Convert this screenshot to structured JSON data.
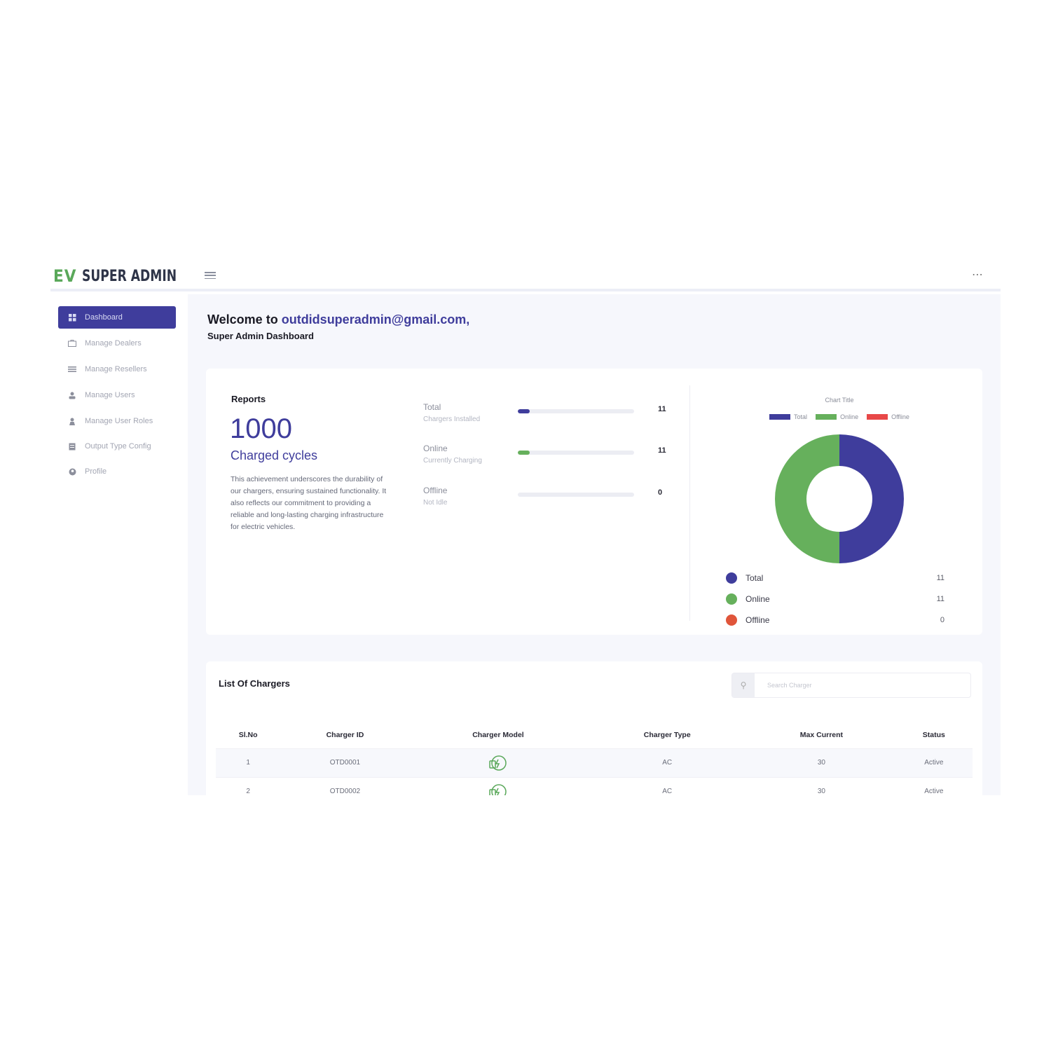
{
  "app": {
    "logo_mark": "EV",
    "logo_text": "SUPER ADMIN"
  },
  "sidebar": {
    "items": [
      {
        "label": "Dashboard",
        "icon": "dashboard-icon",
        "active": true
      },
      {
        "label": "Manage Dealers",
        "icon": "briefcase-icon",
        "active": false
      },
      {
        "label": "Manage Resellers",
        "icon": "list-icon",
        "active": false
      },
      {
        "label": "Manage Users",
        "icon": "users-icon",
        "active": false
      },
      {
        "label": "Manage User Roles",
        "icon": "user-icon",
        "active": false
      },
      {
        "label": "Output Type Config",
        "icon": "config-icon",
        "active": false
      },
      {
        "label": "Profile",
        "icon": "profile-icon",
        "active": false
      }
    ]
  },
  "header": {
    "welcome_prefix": "Welcome to",
    "email": "outdidsuperadmin@gmail.com,",
    "subtitle": "Super Admin Dashboard"
  },
  "reports": {
    "title": "Reports",
    "big_number": "1000",
    "big_label": "Charged cycles",
    "description": "This achievement underscores the durability of our chargers, ensuring sustained functionality. It also reflects our commitment to providing a reliable and long-lasting charging infrastructure for electric vehicles.",
    "stats": [
      {
        "label": "Total",
        "sub": "Chargers Installed",
        "value": "11",
        "fill_fraction": 0.1,
        "color": "#3f3d9c"
      },
      {
        "label": "Online",
        "sub": "Currently Charging",
        "value": "11",
        "fill_fraction": 0.1,
        "color": "#66b05c"
      },
      {
        "label": "Offline",
        "sub": "Not Idle",
        "value": "0",
        "fill_fraction": 0,
        "color": "#e35252"
      }
    ]
  },
  "chart_data": {
    "type": "pie",
    "title": "Chart Title",
    "categories": [
      "Total",
      "Online",
      "Offline"
    ],
    "values": [
      11,
      11,
      0
    ],
    "colors": [
      "#3f3d9c",
      "#66b05c",
      "#e84848"
    ],
    "legend_placement": "top",
    "legend_list": [
      {
        "name": "Total",
        "value": "11",
        "color": "#3f3d9c"
      },
      {
        "name": "Online",
        "value": "11",
        "color": "#66b05c"
      },
      {
        "name": "Offline",
        "value": "0",
        "color": "#e0553a"
      }
    ]
  },
  "chargers": {
    "title": "List Of Chargers",
    "search_placeholder": "Search Charger",
    "columns": [
      "Sl.No",
      "Charger ID",
      "Charger Model",
      "Charger Type",
      "Max Current",
      "Status"
    ],
    "rows": [
      {
        "sl": "1",
        "id": "OTD0001",
        "model_icon": "charger-model-icon",
        "type": "AC",
        "max_current": "30",
        "status": "Active"
      },
      {
        "sl": "2",
        "id": "OTD0002",
        "model_icon": "charger-model-icon",
        "type": "AC",
        "max_current": "30",
        "status": "Active"
      }
    ]
  },
  "colors": {
    "brand": "#3f3d9c",
    "accent_green": "#66b05c",
    "offline_red": "#e84848"
  }
}
